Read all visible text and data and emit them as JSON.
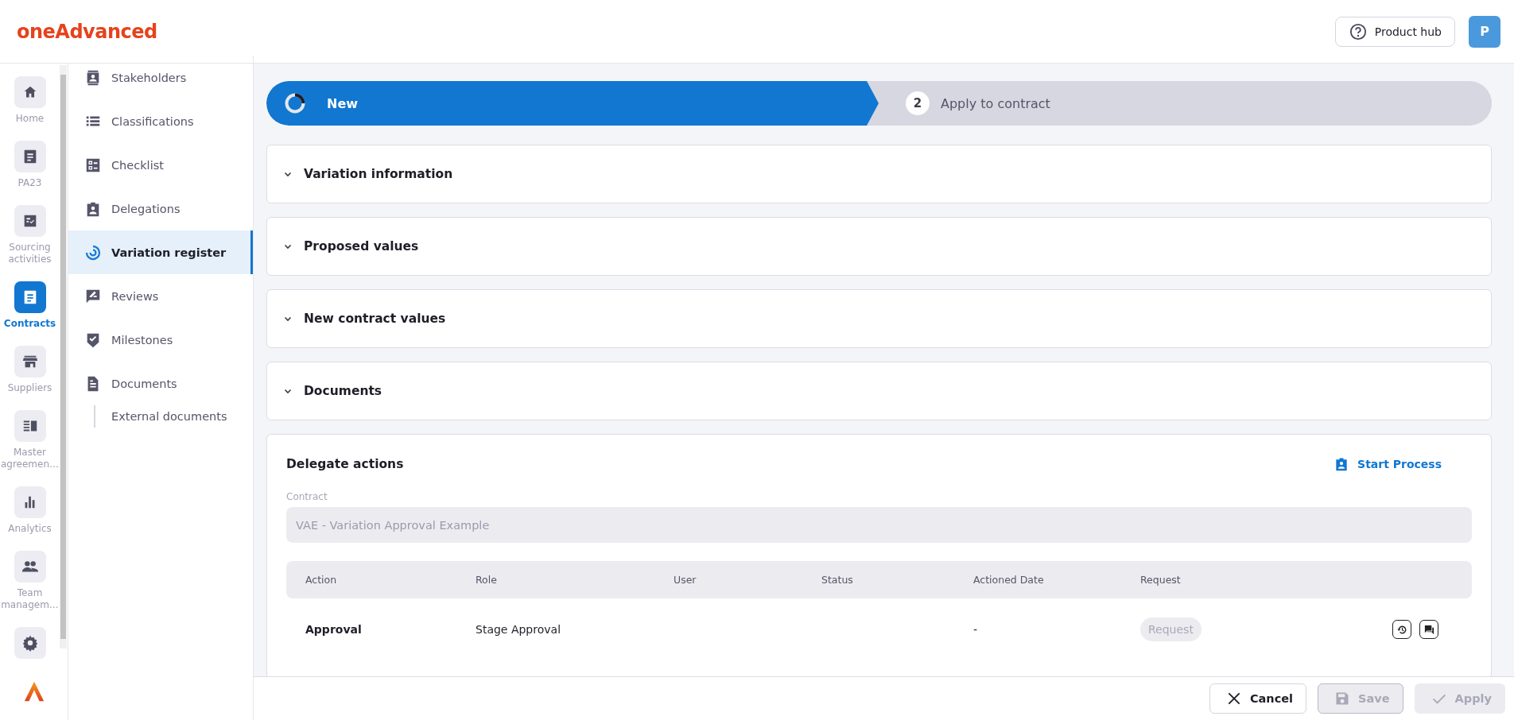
{
  "header": {
    "logo": "oneAdvanced",
    "product_hub": "Product hub",
    "avatar": "P"
  },
  "rail": {
    "items": [
      {
        "label": "Home",
        "selected": false
      },
      {
        "label": "PA23",
        "selected": false
      },
      {
        "label": "Sourcing activities",
        "selected": false
      },
      {
        "label": "Contracts",
        "selected": true
      },
      {
        "label": "Suppliers",
        "selected": false
      },
      {
        "label": "Master agreemen…",
        "selected": false
      },
      {
        "label": "Analytics",
        "selected": false
      },
      {
        "label": "Team managem…",
        "selected": false
      },
      {
        "selected": false
      }
    ]
  },
  "subnav": {
    "items": [
      {
        "label": "Stakeholders",
        "selected": false
      },
      {
        "label": "Classifications",
        "selected": false
      },
      {
        "label": "Checklist",
        "selected": false
      },
      {
        "label": "Delegations",
        "selected": false
      },
      {
        "label": "Variation register",
        "selected": true
      },
      {
        "label": "Reviews",
        "selected": false
      },
      {
        "label": "Milestones",
        "selected": false
      },
      {
        "label": "Documents",
        "selected": false,
        "children": [
          {
            "label": "External documents",
            "selected": false
          }
        ]
      }
    ]
  },
  "stepper": {
    "steps": [
      {
        "label": "New",
        "selected": true
      },
      {
        "number": "2",
        "label": "Apply to contract",
        "selected": false
      }
    ]
  },
  "sections": [
    {
      "title": "Variation information",
      "expanded": false
    },
    {
      "title": "Proposed values",
      "expanded": false
    },
    {
      "title": "New contract values",
      "expanded": false
    },
    {
      "title": "Documents",
      "expanded": false
    }
  ],
  "delegate": {
    "title": "Delegate actions",
    "action_link": "Start Process",
    "contract_label": "Contract",
    "contract_value": "VAE - Variation Approval Example",
    "columns": [
      "Action",
      "Role",
      "User",
      "Status",
      "Actioned Date",
      "Request"
    ],
    "rows": [
      {
        "action": "Approval",
        "role": "Stage Approval",
        "actioned_date": "-",
        "request": "Request",
        "request_disabled": true
      }
    ]
  },
  "footer": {
    "buttons": [
      {
        "label": "Cancel",
        "kind": "cancel",
        "disabled": false
      },
      {
        "label": "Save",
        "kind": "save",
        "disabled": true
      },
      {
        "label": "Apply",
        "kind": "apply",
        "disabled": true
      }
    ]
  }
}
